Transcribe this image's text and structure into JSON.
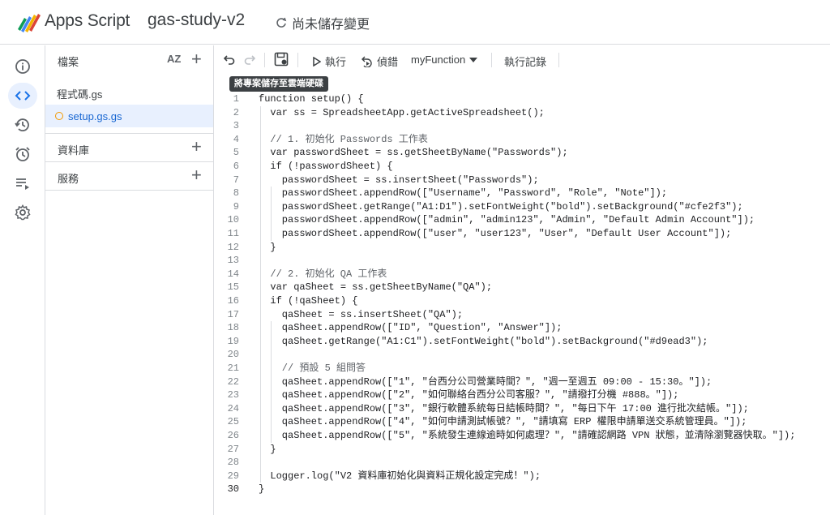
{
  "header": {
    "product": "Apps Script",
    "project": "gas-study-v2",
    "save_state": "尚未儲存變更"
  },
  "rail": {
    "icons": [
      "info-icon",
      "code-icon",
      "history-icon",
      "alarm-icon",
      "executions-icon",
      "settings-icon"
    ]
  },
  "panel": {
    "files_title": "檔案",
    "sort_label": "AZ",
    "files": [
      "程式碼.gs",
      "setup.gs.gs"
    ],
    "libraries": "資料庫",
    "services": "服務"
  },
  "toolbar": {
    "run": "執行",
    "debug": "偵錯",
    "function": "myFunction",
    "log": "執行記錄"
  },
  "tooltip": "將專案儲存至雲端硬碟",
  "code": {
    "lines": [
      "function setup() {",
      "  var ss = SpreadsheetApp.getActiveSpreadsheet();",
      "",
      "  // 1. 初始化 Passwords 工作表",
      "  var passwordSheet = ss.getSheetByName(\"Passwords\");",
      "  if (!passwordSheet) {",
      "    passwordSheet = ss.insertSheet(\"Passwords\");",
      "    passwordSheet.appendRow([\"Username\", \"Password\", \"Role\", \"Note\"]);",
      "    passwordSheet.getRange(\"A1:D1\").setFontWeight(\"bold\").setBackground(\"#cfe2f3\");",
      "    passwordSheet.appendRow([\"admin\", \"admin123\", \"Admin\", \"Default Admin Account\"]);",
      "    passwordSheet.appendRow([\"user\", \"user123\", \"User\", \"Default User Account\"]);",
      "  }",
      "",
      "  // 2. 初始化 QA 工作表",
      "  var qaSheet = ss.getSheetByName(\"QA\");",
      "  if (!qaSheet) {",
      "    qaSheet = ss.insertSheet(\"QA\");",
      "    qaSheet.appendRow([\"ID\", \"Question\", \"Answer\"]);",
      "    qaSheet.getRange(\"A1:C1\").setFontWeight(\"bold\").setBackground(\"#d9ead3\");",
      "",
      "    // 預設 5 組問答",
      "    qaSheet.appendRow([\"1\", \"台西分公司營業時間？\", \"週一至週五 09:00 - 15:30。\"]);",
      "    qaSheet.appendRow([\"2\", \"如何聯絡台西分公司客服？\", \"請撥打分機 #888。\"]);",
      "    qaSheet.appendRow([\"3\", \"銀行軟體系統每日結帳時間？\", \"每日下午 17:00 進行批次結帳。\"]);",
      "    qaSheet.appendRow([\"4\", \"如何申請測試帳號？\", \"請填寫 ERP 權限申請單送交系統管理員。\"]);",
      "    qaSheet.appendRow([\"5\", \"系統發生連線逾時如何處理？\", \"請確認網路 VPN 狀態，並清除瀏覽器快取。\"]);",
      "  }",
      "",
      "  Logger.log(\"V2 資料庫初始化與資料正規化設定完成！\");",
      "}"
    ]
  }
}
